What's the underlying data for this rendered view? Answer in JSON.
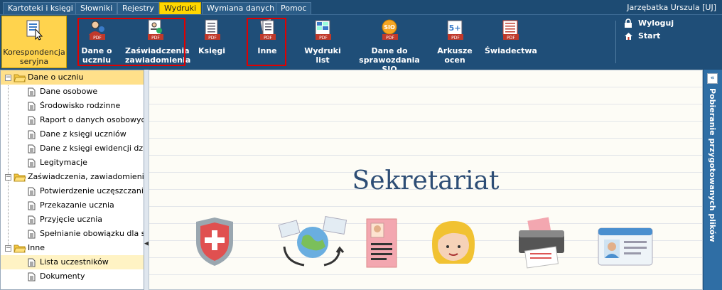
{
  "menu": {
    "tabs": [
      {
        "label": "Kartoteki i księgi"
      },
      {
        "label": "Słowniki"
      },
      {
        "label": "Rejestry"
      },
      {
        "label": "Wydruki"
      },
      {
        "label": "Wymiana danych"
      },
      {
        "label": "Pomoc"
      }
    ],
    "user": "Jarzębatka Urszula [UJ]"
  },
  "ribbon": {
    "buttons": [
      {
        "label": "Korespondencja seryjna"
      },
      {
        "label": "Dane o uczniu"
      },
      {
        "label": "Zaświadczenia zawiadomienia"
      },
      {
        "label": "Księgi"
      },
      {
        "label": "Inne"
      },
      {
        "label": "Wydruki list"
      },
      {
        "label": "Dane do sprawozdania SIO"
      },
      {
        "label": "Arkusze ocen"
      },
      {
        "label": "Świadectwa"
      }
    ],
    "pdf": "PDF",
    "sio": "SIO",
    "five": "5+",
    "logout": "Wyloguj",
    "start": "Start"
  },
  "tree": {
    "groups": [
      {
        "label": "Dane o uczniu",
        "items": [
          "Dane osobowe",
          "Środowisko rodzinne",
          "Raport o danych osobowych",
          "Dane z księgi uczniów",
          "Dane z księgi ewidencji dzieci",
          "Legitymacje"
        ]
      },
      {
        "label": "Zaświadczenia, zawiadomienia",
        "items": [
          "Potwierdzenie uczęszczania do",
          "Przekazanie ucznia",
          "Przyjęcie ucznia",
          "Spełnianie obowiązku dla szkó"
        ]
      },
      {
        "label": "Inne",
        "items": [
          "Lista uczestników",
          "Dokumenty"
        ]
      }
    ],
    "selected": "Lista uczestników"
  },
  "main": {
    "title": "Sekretariat"
  },
  "right_panel": {
    "label": "Pobieranie przygotowanych plików",
    "collapse": "«"
  },
  "colors": {
    "accent": "#ffd34d",
    "header": "#1f4e78",
    "highlight": "#e00000"
  }
}
